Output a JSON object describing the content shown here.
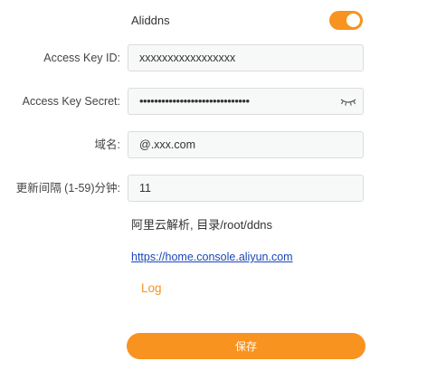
{
  "header": {
    "title": "Aliddns",
    "enabled": true,
    "accent_color": "#f7931e"
  },
  "form": {
    "access_key_id": {
      "label": "Access Key ID:",
      "value": "xxxxxxxxxxxxxxxxx"
    },
    "access_key_secret": {
      "label": "Access Key Secret:",
      "masked_value": "••••••••••••••••••••••••••••••",
      "toggle_icon": "eye-closed-icon"
    },
    "domain": {
      "label": "域名:",
      "value": "@.xxx.com"
    },
    "interval": {
      "label": "更新间隔 (1-59)分钟:",
      "value": "11"
    }
  },
  "info": {
    "note": "阿里云解析, 目录/root/ddns",
    "link": "https://home.console.aliyun.com",
    "log_label": "Log"
  },
  "footer": {
    "save_label": "保存"
  }
}
